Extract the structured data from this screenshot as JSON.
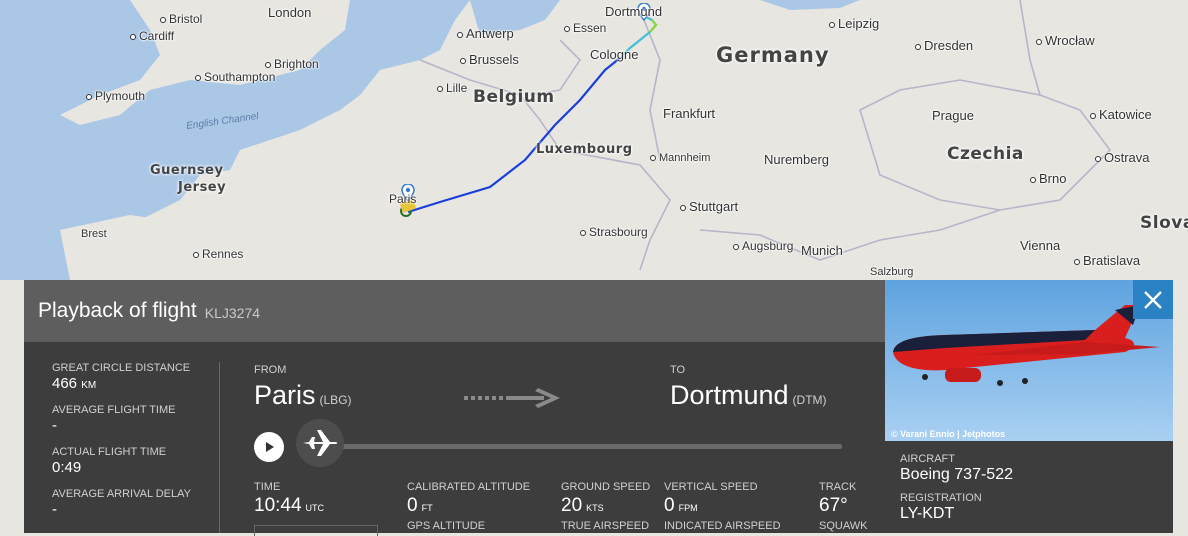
{
  "map": {
    "cities": [
      "London",
      "Bristol",
      "Cardiff",
      "Brighton",
      "Southampton",
      "Plymouth",
      "Antwerp",
      "Brussels",
      "Lille",
      "Essen",
      "Dortmund",
      "Cologne",
      "Leipzig",
      "Dresden",
      "Wrocław",
      "Frankfurt",
      "Mannheim",
      "Nuremberg",
      "Stuttgart",
      "Strasbourg",
      "Augsburg",
      "Munich",
      "Salzburg",
      "Prague",
      "Katowice",
      "Ostrava",
      "Brno",
      "Vienna",
      "Bratislava",
      "Rennes",
      "Brest",
      "Paris"
    ],
    "countries": [
      "Germany",
      "Belgium",
      "Luxembourg",
      "Czechia",
      "Slova"
    ],
    "islands": [
      "Guernsey",
      "Jersey"
    ],
    "sea": "English Channel",
    "colors": {
      "land": "#e8e6e1",
      "sea": "#aac7e6",
      "track_start": "#1a3fd9",
      "track_mid": "#1e6fe8",
      "track_end": "#8fd63a"
    }
  },
  "panel": {
    "title": "Playback of flight",
    "flight": "KLJ3274",
    "stats": {
      "great_circle_label": "GREAT CIRCLE DISTANCE",
      "great_circle_value": "466",
      "great_circle_unit": "KM",
      "avg_flight_label": "AVERAGE FLIGHT TIME",
      "avg_flight_value": "-",
      "actual_flight_label": "ACTUAL FLIGHT TIME",
      "actual_flight_value": "0:49",
      "avg_delay_label": "AVERAGE ARRIVAL DELAY",
      "avg_delay_value": "-"
    },
    "route": {
      "from_label": "FROM",
      "from_city": "Paris",
      "from_code": "(LBG)",
      "to_label": "TO",
      "to_city": "Dortmund",
      "to_code": "(DTM)"
    },
    "playback_progress": 0,
    "telemetry": {
      "time_label": "TIME",
      "time_value": "10:44",
      "time_unit": "UTC",
      "cal_alt_label": "CALIBRATED ALTITUDE",
      "cal_alt_value": "0",
      "cal_alt_unit": "FT",
      "gps_alt_label": "GPS ALTITUDE",
      "ground_speed_label": "GROUND SPEED",
      "ground_speed_value": "20",
      "ground_speed_unit": "KTS",
      "true_airspeed_label": "TRUE AIRSPEED",
      "vertical_speed_label": "VERTICAL SPEED",
      "vertical_speed_value": "0",
      "vertical_speed_unit": "FPM",
      "indicated_airspeed_label": "INDICATED AIRSPEED",
      "track_label": "TRACK",
      "track_value": "67°",
      "squawk_label": "SQUAWK"
    }
  },
  "aircraft": {
    "photo_credit": "© Varani Ennio | Jetphotos",
    "type_label": "AIRCRAFT",
    "type_value": "Boeing 737-522",
    "reg_label": "REGISTRATION",
    "reg_value": "LY-KDT"
  }
}
